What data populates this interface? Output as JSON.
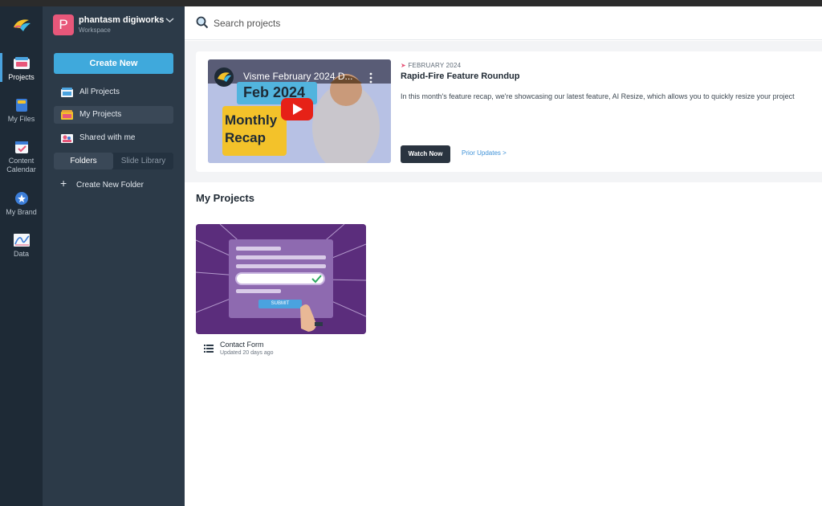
{
  "rail": {
    "items": [
      {
        "label": "Projects",
        "icon": "projects-icon"
      },
      {
        "label": "My Files",
        "icon": "files-icon"
      },
      {
        "label": "Content Calendar",
        "icon": "calendar-icon"
      },
      {
        "label": "My Brand",
        "icon": "brand-icon"
      },
      {
        "label": "Data",
        "icon": "data-icon"
      }
    ]
  },
  "workspace": {
    "initial": "P",
    "name": "phantasm digiworks",
    "sub": "Workspace"
  },
  "sidebar": {
    "create_label": "Create New",
    "items": [
      {
        "label": "All Projects"
      },
      {
        "label": "My Projects"
      },
      {
        "label": "Shared with me"
      }
    ],
    "tabs": [
      "Folders",
      "Slide Library"
    ],
    "new_folder_label": "Create New Folder"
  },
  "search": {
    "placeholder": "Search projects"
  },
  "banner": {
    "video_title": "Visme February 2024 D...",
    "thumb_line1": "Feb 2024",
    "thumb_line2": "Monthly",
    "thumb_line3": "Recap",
    "tag": "FEBRUARY 2024",
    "title": "Rapid-Fire Feature Roundup",
    "description": "In this month's feature recap, we're showcasing our latest feature, AI Resize, which allows you to quickly resize your project",
    "watch_label": "Watch Now",
    "prior_label": "Prior Updates >"
  },
  "projects": {
    "title": "My Projects",
    "cards": [
      {
        "name": "Contact Form",
        "updated": "Updated 20 days ago",
        "thumb_button": "SUBMIT"
      }
    ]
  },
  "colors": {
    "accent": "#3fa9dc",
    "rail": "#1e2a36",
    "sidebar": "#2c3a48",
    "card_bg": "#5b2d7c"
  }
}
